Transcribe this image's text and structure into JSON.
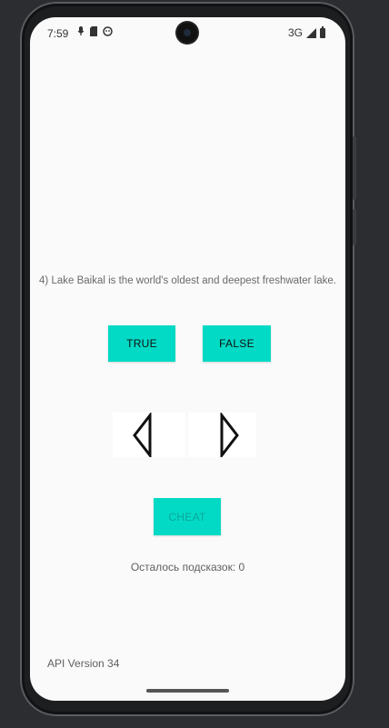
{
  "status_bar": {
    "time": "7:59",
    "network": "3G",
    "icons": [
      "mic-icon",
      "sd-card-icon",
      "android-icon",
      "signal-icon",
      "battery-icon"
    ]
  },
  "quiz": {
    "question": "4) Lake Baikal is the world's oldest and deepest freshwater lake.",
    "true_label": "TRUE",
    "false_label": "FALSE",
    "prev_icon": "triangle-left-icon",
    "next_icon": "triangle-right-icon",
    "cheat_label": "CHEAT",
    "hints_text": "Осталось подсказок: 0"
  },
  "footer": {
    "api_version": "API Version 34"
  },
  "colors": {
    "accent": "#03dac5",
    "background": "#fafafa"
  }
}
